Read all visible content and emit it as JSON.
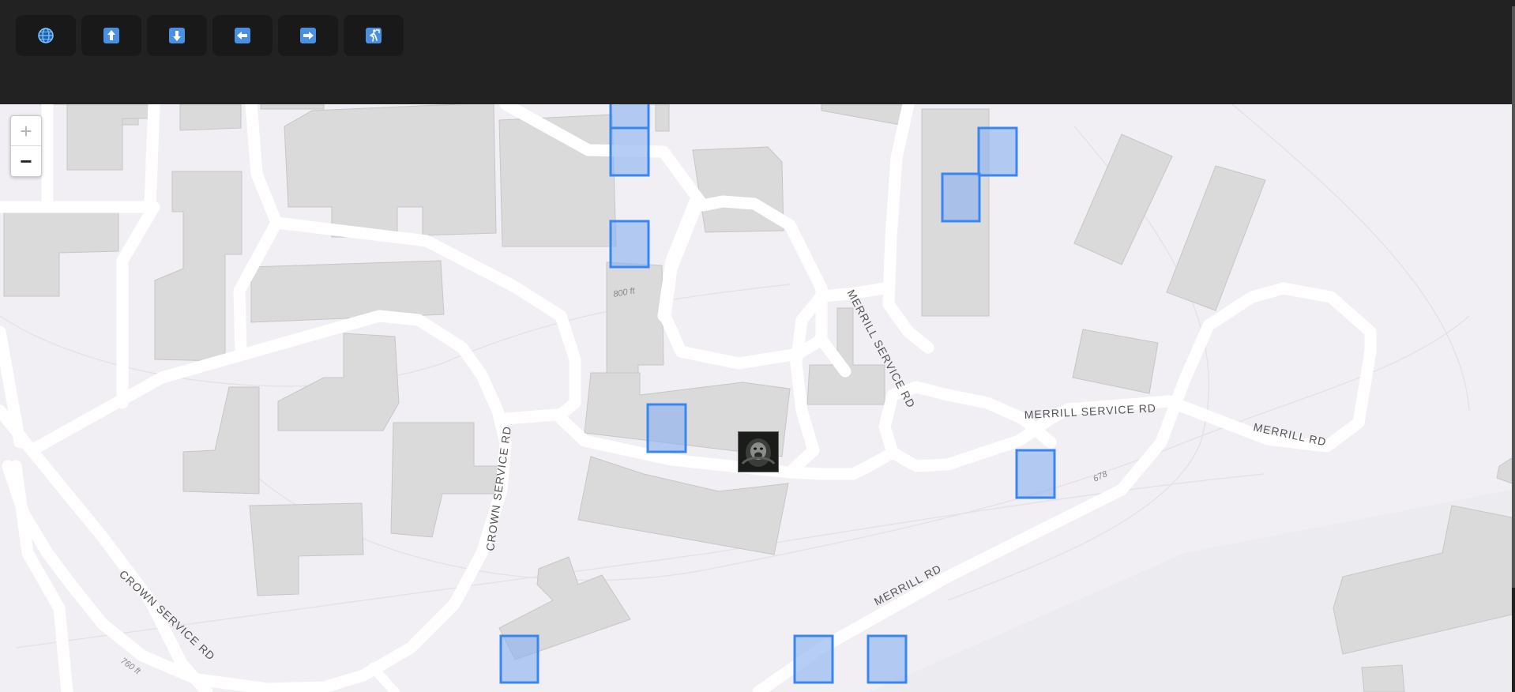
{
  "toolbar": {
    "buttons": [
      {
        "id": "globe",
        "icon": "globe-icon"
      },
      {
        "id": "up",
        "icon": "arrow-up-icon"
      },
      {
        "id": "down",
        "icon": "arrow-down-icon"
      },
      {
        "id": "left",
        "icon": "arrow-left-icon"
      },
      {
        "id": "right",
        "icon": "arrow-right-icon"
      },
      {
        "id": "pedestrian",
        "icon": "pedestrian-icon"
      }
    ]
  },
  "zoom": {
    "in_label": "+",
    "out_label": "−"
  },
  "map": {
    "road_labels": {
      "merrill_service_rd_vertical": "MERRILL SERVICE RD",
      "merrill_service_rd_horizontal": "MERRILL SERVICE RD",
      "merrill_rd_east": "MERRILL RD",
      "merrill_rd_south": "MERRILL RD",
      "crown_service_rd_vertical": "CROWN SERVICE RD",
      "crown_service_rd_diagonal": "CROWN SERVICE RD"
    },
    "contour_labels": {
      "c800": "800 ft",
      "c760": "760 ft",
      "c678": "678"
    },
    "colors": {
      "background": "#f2eff4",
      "building": "#dadada",
      "road": "#ffffff",
      "marker_fill": "#8fb4f0",
      "marker_stroke": "#3a86f0"
    }
  }
}
